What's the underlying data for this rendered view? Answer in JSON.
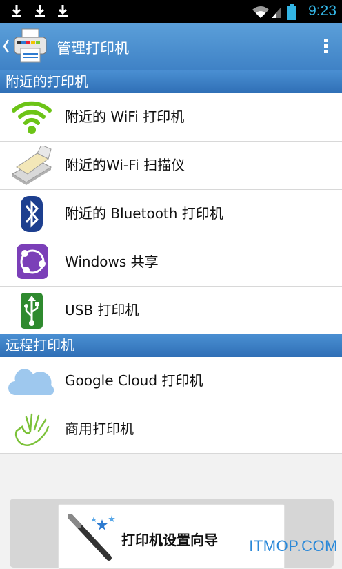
{
  "status_bar": {
    "time": "9:23"
  },
  "app_bar": {
    "title": "管理打印机"
  },
  "sections": {
    "nearby": "附近的打印机",
    "remote": "远程打印机"
  },
  "nearby_items": [
    {
      "label": "附近的 WiFi 打印机",
      "icon": "wifi-icon"
    },
    {
      "label": "附近的Wi-Fi 扫描仪",
      "icon": "scanner-icon"
    },
    {
      "label": "附近的 Bluetooth 打印机",
      "icon": "bluetooth-icon"
    },
    {
      "label": "Windows 共享",
      "icon": "windows-share-icon"
    },
    {
      "label": "USB 打印机",
      "icon": "usb-icon"
    }
  ],
  "remote_items": [
    {
      "label": "Google Cloud 打印机",
      "icon": "cloud-icon"
    },
    {
      "label": "商用打印机",
      "icon": "hand-icon"
    }
  ],
  "wizard": {
    "label": "打印机设置向导"
  },
  "watermark": "ITMOP.COM",
  "colors": {
    "app_bar": "#4a8fd2",
    "section_header": "#3a7cc2",
    "time": "#33b5e5"
  }
}
